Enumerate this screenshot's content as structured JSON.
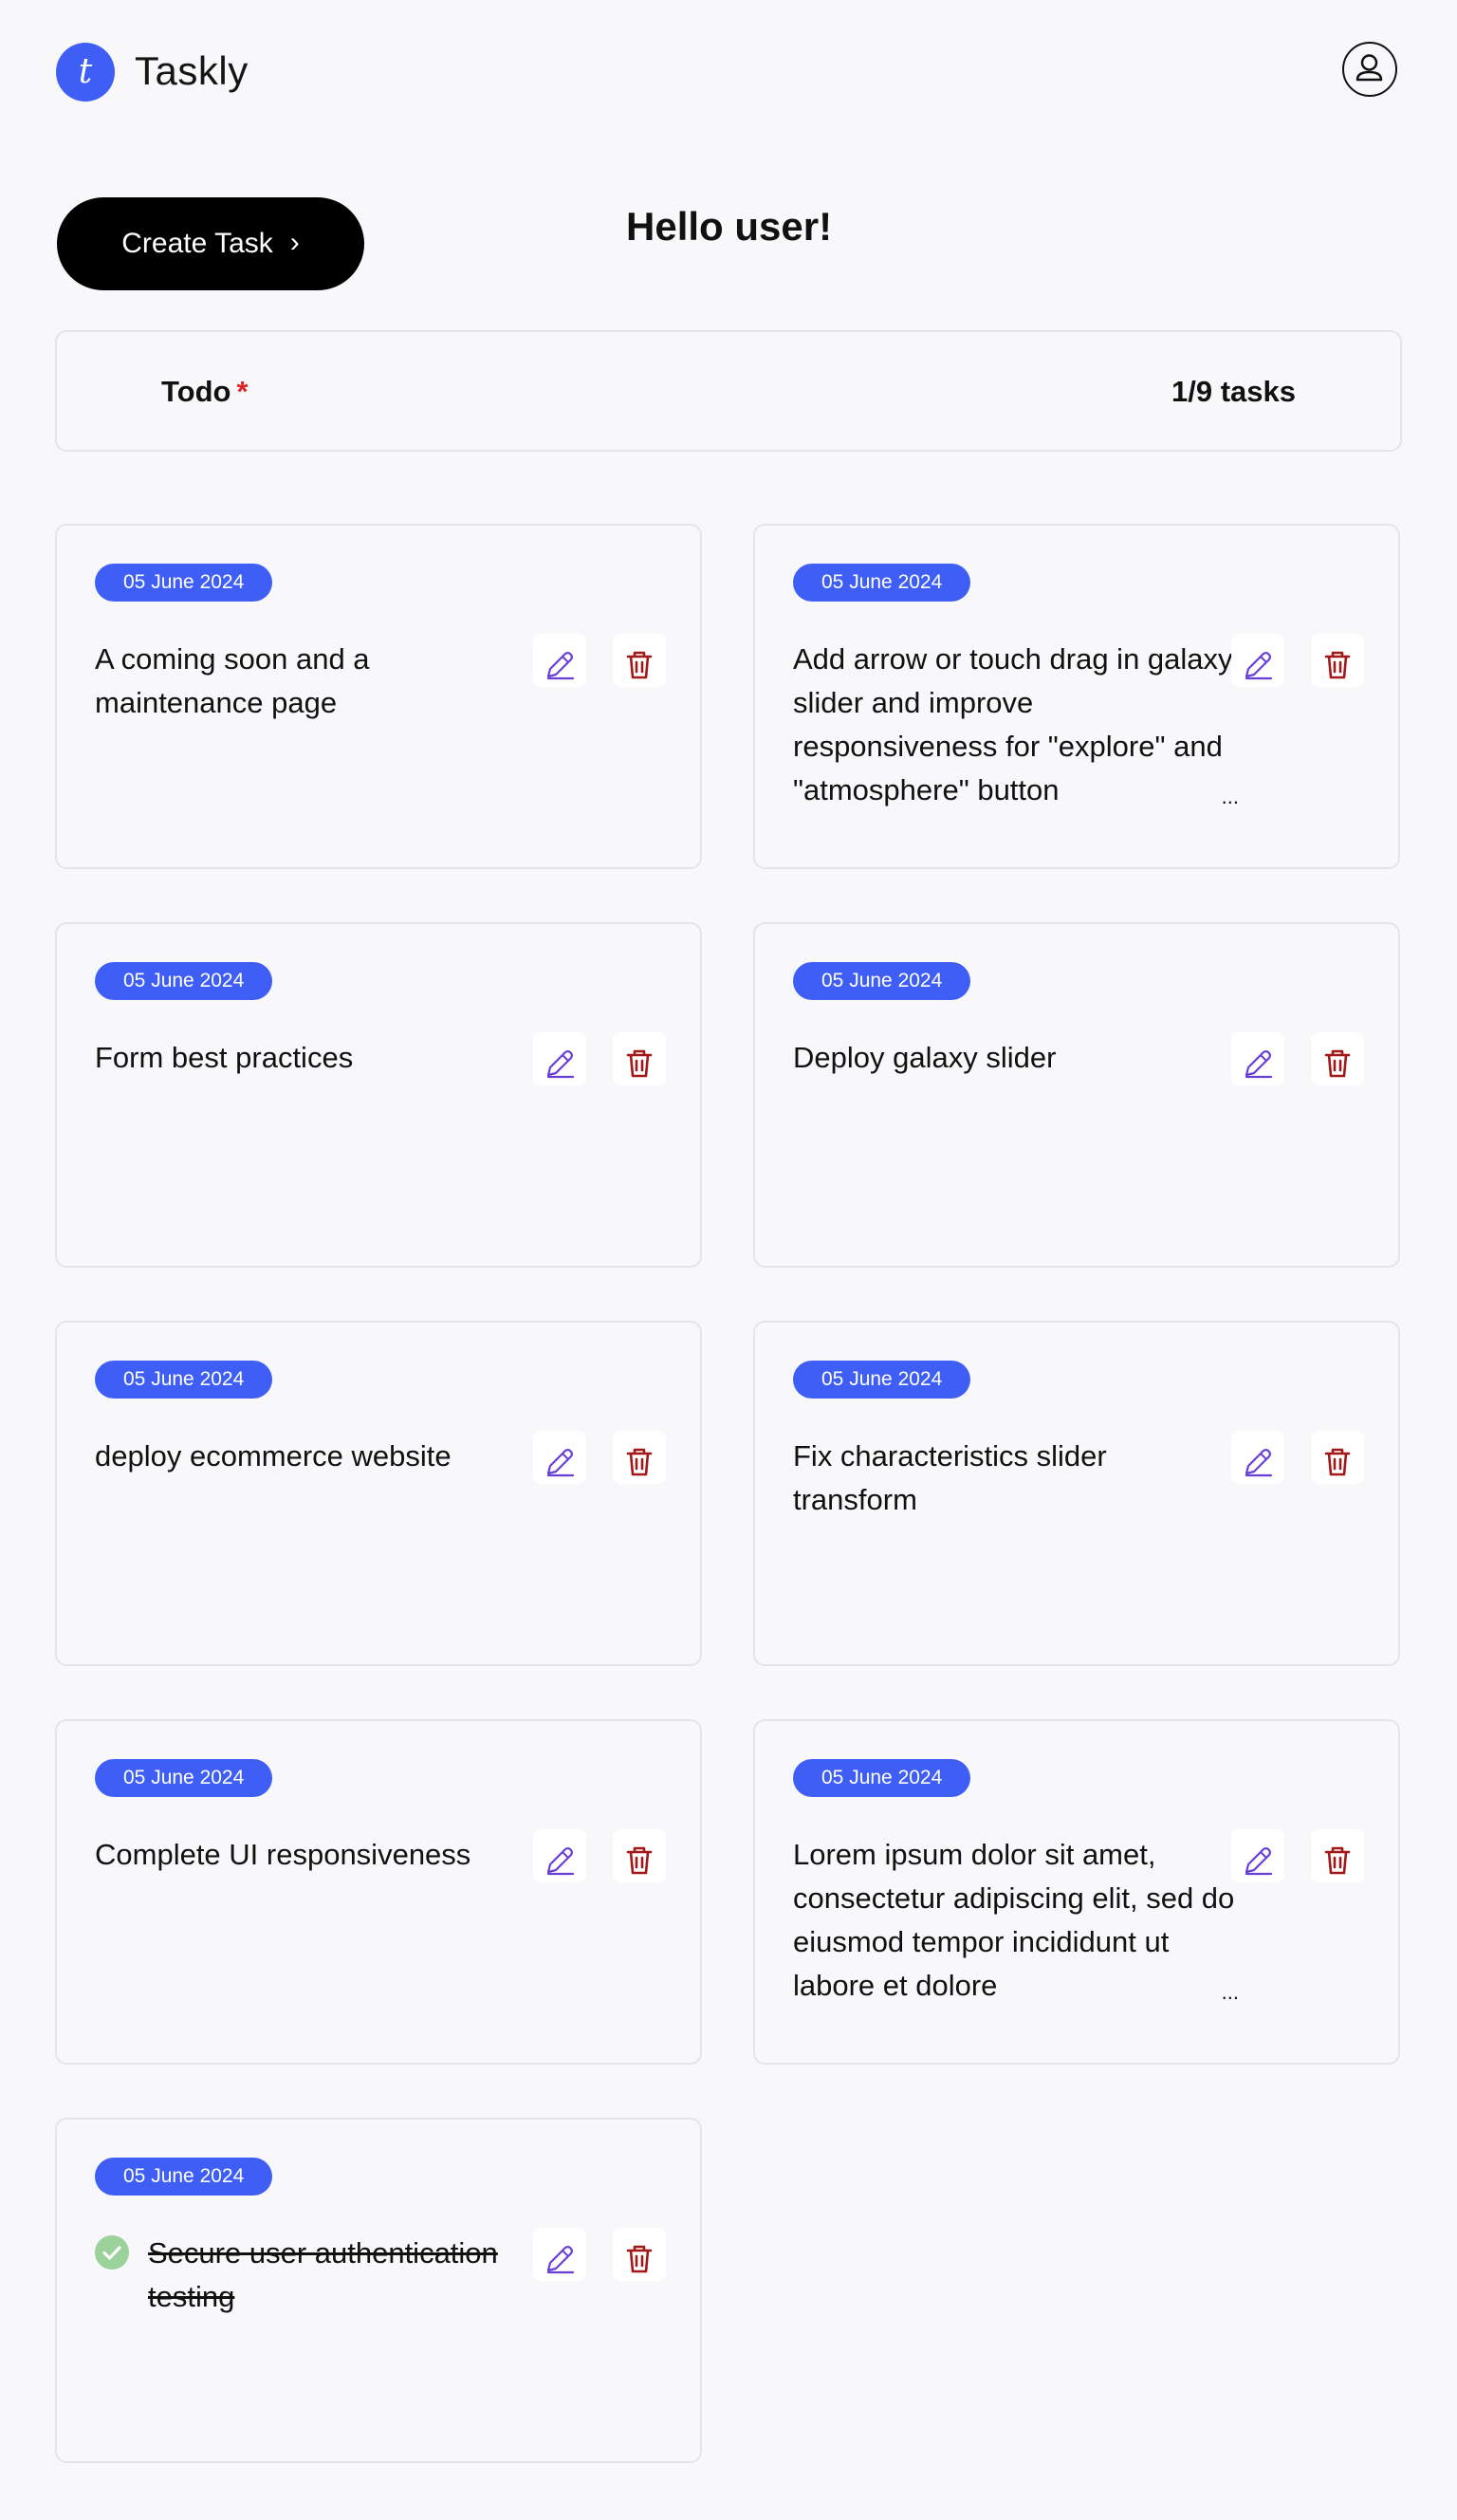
{
  "app": {
    "logo_letter": "t",
    "name": "Taskly"
  },
  "header": {
    "profile_icon": "user-circle-icon"
  },
  "actions": {
    "create_label": "Create Task",
    "create_chevron": "›",
    "greeting": "Hello user!"
  },
  "todo": {
    "title": "Todo",
    "required_mark": "*",
    "count": "1/9 tasks"
  },
  "colors": {
    "accent": "#3f5ef5",
    "edit_icon": "#6a3fd6",
    "delete_icon": "#a01818",
    "done_check": "#9bd19a"
  },
  "tasks": [
    {
      "date": "05 June 2024",
      "text": "A coming soon and a maintenance page",
      "done": false
    },
    {
      "date": "05 June 2024",
      "text": "Add arrow or touch drag in galaxy slider and improve responsiveness for \"explore\" and \"atmosphere\" button",
      "done": false
    },
    {
      "date": "05 June 2024",
      "text": "Form best practices",
      "done": false
    },
    {
      "date": "05 June 2024",
      "text": "Deploy galaxy slider",
      "done": false
    },
    {
      "date": "05 June 2024",
      "text": "deploy ecommerce website",
      "done": false
    },
    {
      "date": "05 June 2024",
      "text": "Fix characteristics slider transform",
      "done": false
    },
    {
      "date": "05 June 2024",
      "text": "Complete UI responsiveness",
      "done": false
    },
    {
      "date": "05 June 2024",
      "text": "Lorem ipsum dolor sit amet, consectetur adipiscing elit, sed do eiusmod tempor incididunt ut labore et dolore",
      "done": false
    },
    {
      "date": "05 June 2024",
      "text": "Secure user authentication testing",
      "done": true
    }
  ]
}
